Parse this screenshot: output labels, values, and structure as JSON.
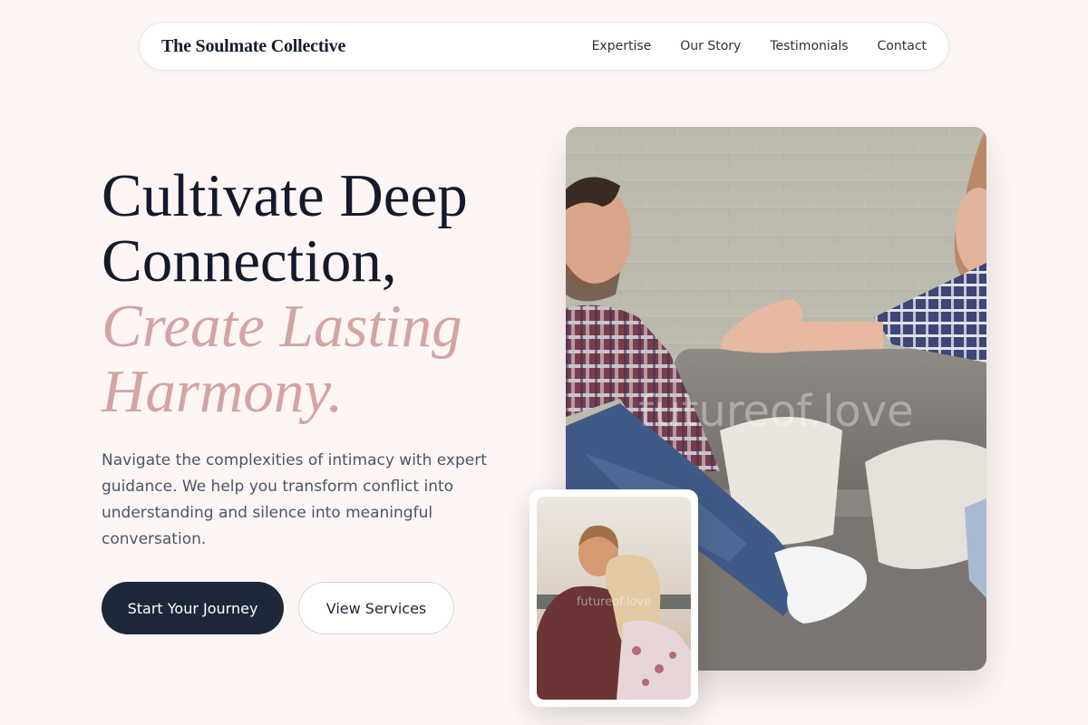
{
  "nav": {
    "brand": "The Soulmate Collective",
    "links": [
      "Expertise",
      "Our Story",
      "Testimonials",
      "Contact"
    ]
  },
  "hero": {
    "headline_line1": "Cultivate Deep",
    "headline_line2": "Connection,",
    "headline_accent1": "Create Lasting",
    "headline_accent2": "Harmony.",
    "description": "Navigate the complexities of intimacy with expert guidance. We help you transform conflict into understanding and silence into meaningful conversation.",
    "primary_button": "Start Your Journey",
    "secondary_button": "View Services"
  },
  "images": {
    "main_watermark": "futureof.love",
    "small_watermark": "futureof.love"
  },
  "colors": {
    "background": "#fdf6f5",
    "accent": "#d3a4a2",
    "primary_dark": "#1e2739"
  }
}
